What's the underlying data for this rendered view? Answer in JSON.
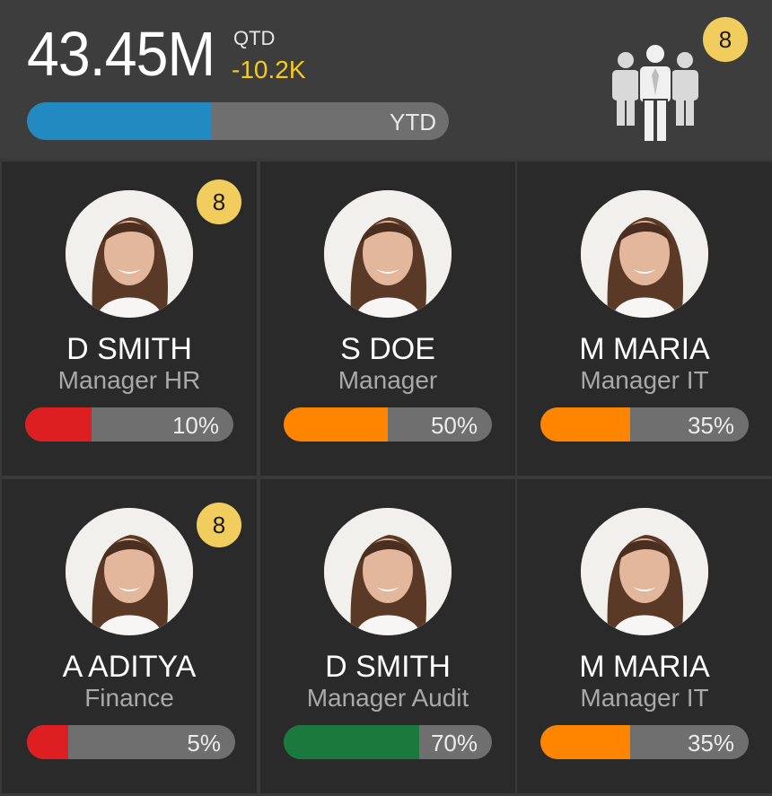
{
  "header": {
    "total": "43.45M",
    "qtd_label": "QTD",
    "qtd_delta": "-10.2K",
    "ytd_label": "YTD",
    "ytd_progress": 0.436,
    "group_icon": "people-group-icon",
    "team_count": "8",
    "colors": {
      "ytd_fill": "#2389c1",
      "delta": "#f5cb1f",
      "badge": "#f0cd5c"
    }
  },
  "people": [
    {
      "name": "D SMITH",
      "role": "Manager HR",
      "percent": "10%",
      "fill": 0.32,
      "color": "#dd1f21",
      "badge": "8"
    },
    {
      "name": "S DOE",
      "role": "Manager",
      "percent": "50%",
      "fill": 0.5,
      "color": "#ff8400",
      "badge": ""
    },
    {
      "name": "M MARIA",
      "role": "Manager IT",
      "percent": "35%",
      "fill": 0.43,
      "color": "#ff8400",
      "badge": ""
    },
    {
      "name": "A ADITYA",
      "role": "Finance",
      "percent": "5%",
      "fill": 0.2,
      "color": "#dd1f21",
      "badge": "8"
    },
    {
      "name": "D SMITH",
      "role": "Manager Audit",
      "percent": "70%",
      "fill": 0.65,
      "color": "#1a7a3d",
      "badge": ""
    },
    {
      "name": "M MARIA",
      "role": "Manager IT",
      "percent": "35%",
      "fill": 0.43,
      "color": "#ff8400",
      "badge": ""
    }
  ]
}
